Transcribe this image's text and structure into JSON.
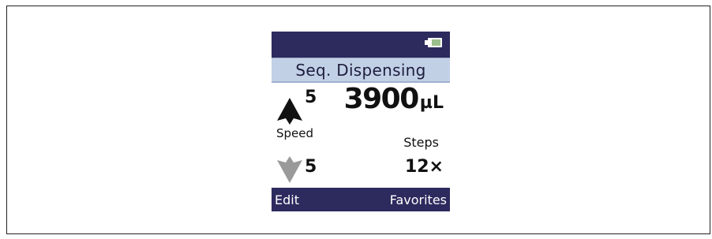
{
  "screen": {
    "title": "Seq. Dispensing",
    "battery_icon": "battery-icon",
    "speed": {
      "label": "Speed",
      "aspirate_value": "5",
      "dispense_value": "5",
      "aspirate_icon": "up-arrow-icon",
      "dispense_icon": "down-arrow-icon"
    },
    "volume": {
      "value": "3900",
      "unit": "µL"
    },
    "steps": {
      "label": "Steps",
      "value": "12×"
    },
    "softkeys": {
      "left": "Edit",
      "right": "Favorites"
    }
  },
  "colors": {
    "bar": "#2d2a5e",
    "title_bg": "#c2d0e6",
    "battery_fill": "#9bbe8d",
    "up_arrow": "#111111",
    "down_arrow": "#9a9a9a"
  }
}
